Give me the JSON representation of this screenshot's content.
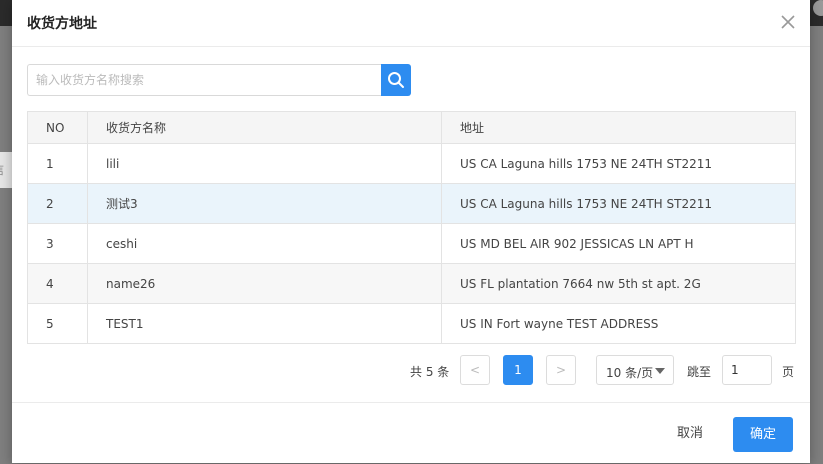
{
  "background": {
    "left_card_text": "信息"
  },
  "modal": {
    "title": "收货方地址",
    "search": {
      "placeholder": "输入收货方名称搜索",
      "value": ""
    },
    "table": {
      "headers": [
        "NO",
        "收货方名称",
        "地址"
      ],
      "rows": [
        {
          "no": "1",
          "name": "lili",
          "address": "US CA Laguna hills 1753 NE 24TH ST2211"
        },
        {
          "no": "2",
          "name": "测试3",
          "address": "US CA Laguna hills 1753 NE 24TH ST2211"
        },
        {
          "no": "3",
          "name": "ceshi",
          "address": "US MD BEL AIR 902 JESSICAS LN APT H"
        },
        {
          "no": "4",
          "name": "name26",
          "address": "US FL plantation 7664 nw 5th st apt. 2G"
        },
        {
          "no": "5",
          "name": "TEST1",
          "address": "US IN Fort wayne TEST ADDRESS"
        }
      ]
    },
    "pagination": {
      "total_text": "共 5 条",
      "prev": "<",
      "next": ">",
      "current_page": "1",
      "page_size": "10 条/页",
      "jump_label": "跳至",
      "jump_value": "1",
      "page_label": "页"
    },
    "footer": {
      "cancel_label": "取消",
      "ok_label": "确定"
    }
  },
  "colors": {
    "primary": "#2d8cf0",
    "row_highlight": "#eaf4fb",
    "overlay": "#7f7f7f"
  },
  "icons": {
    "close": "close-icon",
    "search": "search-icon",
    "dropdown": "chevron-down-icon"
  }
}
